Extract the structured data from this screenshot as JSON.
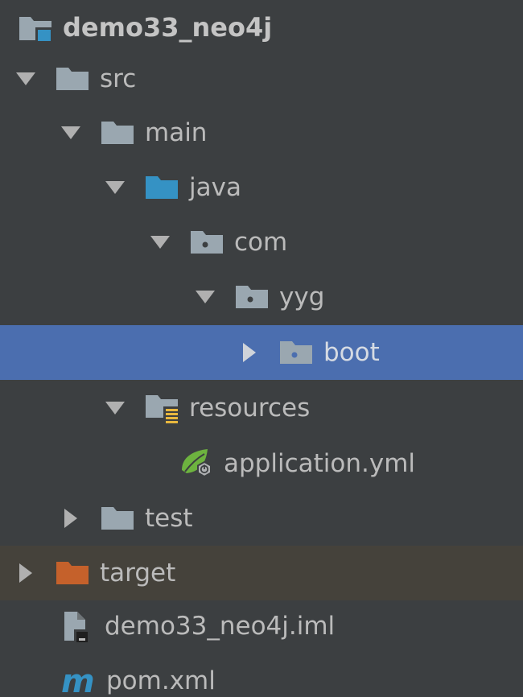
{
  "project_tree": {
    "root": {
      "label": "demo33_neo4j",
      "icon": "project-module-icon"
    },
    "items": [
      {
        "label": "src",
        "icon": "folder-icon",
        "state": "expanded"
      },
      {
        "label": "main",
        "icon": "folder-icon",
        "state": "expanded"
      },
      {
        "label": "java",
        "icon": "source-root-folder-icon",
        "state": "expanded"
      },
      {
        "label": "com",
        "icon": "package-icon",
        "state": "expanded"
      },
      {
        "label": "yyg",
        "icon": "package-icon",
        "state": "expanded"
      },
      {
        "label": "boot",
        "icon": "package-icon",
        "state": "collapsed",
        "selected": true
      },
      {
        "label": "resources",
        "icon": "resources-root-folder-icon",
        "state": "expanded"
      },
      {
        "label": "application.yml",
        "icon": "spring-boot-config-icon",
        "state": "leaf"
      },
      {
        "label": "test",
        "icon": "folder-icon",
        "state": "collapsed"
      },
      {
        "label": "target",
        "icon": "excluded-folder-icon",
        "state": "collapsed"
      },
      {
        "label": "demo33_neo4j.iml",
        "icon": "iml-file-icon",
        "state": "leaf"
      },
      {
        "label": "pom.xml",
        "icon": "maven-icon",
        "state": "leaf"
      }
    ]
  },
  "colors": {
    "background": "#3c3f41",
    "selection": "#4b6eaf",
    "excluded_row": "#45423b",
    "text": "#bbbbbb",
    "folder": "#9aa7b0",
    "source_folder": "#3592c4",
    "excluded_folder": "#c5612b"
  }
}
